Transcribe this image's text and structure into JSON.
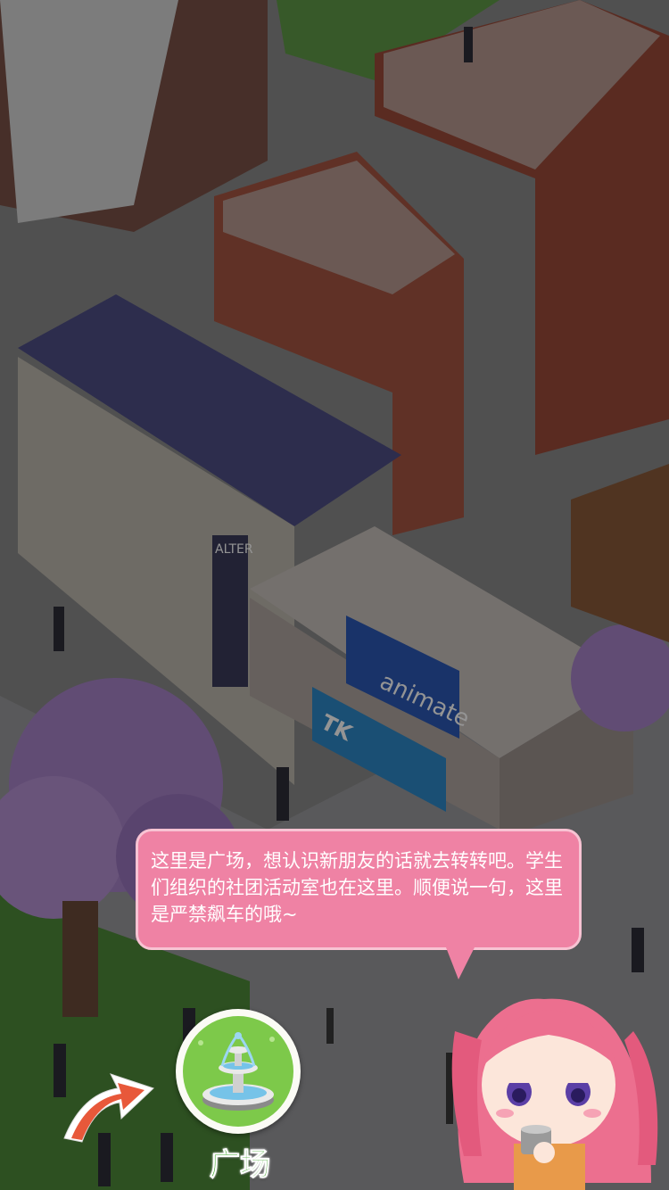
{
  "tutorial": {
    "message": "这里是广场，想认识新朋友的话就去转转吧。学生们组织的社团活动室也在这里。顺便说一句，这里是严禁飙车的哦~"
  },
  "target_button": {
    "label": "广场",
    "icon": "fountain-icon"
  },
  "pointer": {
    "icon": "pointer-arrow-icon"
  },
  "guide_character": {
    "icon": "pink-hair-girl-character"
  },
  "signage": {
    "animate": "animate",
    "alter": "ALTER",
    "tk": "TK"
  },
  "colors": {
    "bubble": "#ef82a4",
    "button_green": "#7dc94a",
    "label_green": "#3fa52b"
  }
}
